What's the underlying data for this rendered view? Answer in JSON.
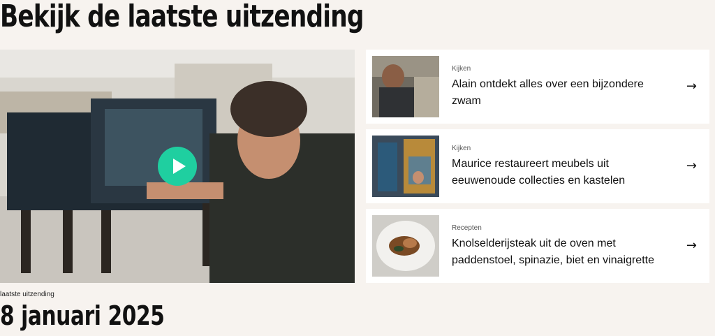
{
  "section": {
    "title": "Bekijk de laatste uitzending",
    "latest_label": "laatste uitzending",
    "latest_date": "8 januari 2025"
  },
  "colors": {
    "accent": "#1fcfa0",
    "background": "#f7f3ef"
  },
  "cards": [
    {
      "category": "Kijken",
      "title": "Alain ontdekt alles over een bijzondere zwam",
      "icon": "arrow-right-icon"
    },
    {
      "category": "Kijken",
      "title": "Maurice restaureert meubels uit eeuwenoude collecties en kastelen",
      "icon": "arrow-right-icon"
    },
    {
      "category": "Recepten",
      "title": "Knolselderijsteak uit de oven met paddenstoel, spinazie, biet en vinaigrette",
      "icon": "arrow-right-icon"
    }
  ],
  "icons": {
    "arrow": "→"
  }
}
